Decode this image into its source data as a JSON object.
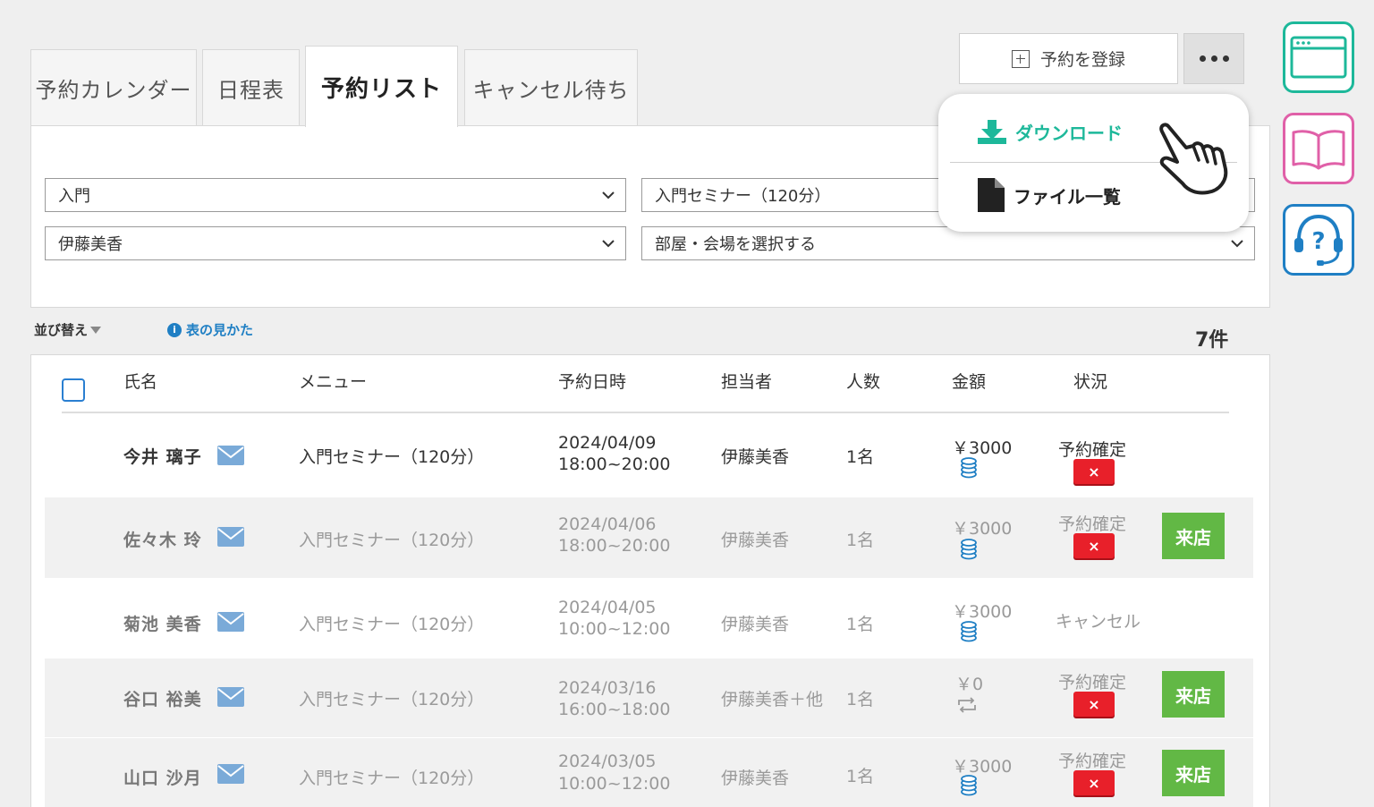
{
  "tabs": [
    {
      "label": "予約カレンダー"
    },
    {
      "label": "日程表"
    },
    {
      "label": "予約リスト"
    },
    {
      "label": "キャンセル待ち"
    }
  ],
  "toolbar": {
    "register_label": "予約を登録"
  },
  "dropdown": {
    "download_label": "ダウンロード",
    "files_label": "ファイル一覧"
  },
  "filters": {
    "category": "入門",
    "menu": "入門セミナー（120分）",
    "staff": "伊藤美香",
    "room_placeholder": "部屋・会場を選択する"
  },
  "list_meta": {
    "sort_label": "並び替え",
    "help_label": "表の見かた",
    "count": "7件"
  },
  "columns": {
    "name": "氏名",
    "menu": "メニュー",
    "datetime": "予約日時",
    "staff": "担当者",
    "people": "人数",
    "amount": "金額",
    "status": "状況"
  },
  "rows": [
    {
      "name": "今井 璃子",
      "menu": "入門セミナー（120分）",
      "date": "2024/04/09",
      "time": "18:00~20:00",
      "staff": "伊藤美香",
      "people": "1名",
      "amount": "￥3000",
      "status": "予約確定",
      "visit": ""
    },
    {
      "name": "佐々木 玲",
      "menu": "入門セミナー（120分）",
      "date": "2024/04/06",
      "time": "18:00~20:00",
      "staff": "伊藤美香",
      "people": "1名",
      "amount": "￥3000",
      "status": "予約確定",
      "visit": "来店"
    },
    {
      "name": "菊池 美香",
      "menu": "入門セミナー（120分）",
      "date": "2024/04/05",
      "time": "10:00~12:00",
      "staff": "伊藤美香",
      "people": "1名",
      "amount": "￥3000",
      "status": "キャンセル",
      "visit": ""
    },
    {
      "name": "谷口 裕美",
      "menu": "入門セミナー（120分）",
      "date": "2024/03/16",
      "time": "16:00~18:00",
      "staff": "伊藤美香＋他",
      "people": "1名",
      "amount": "￥0",
      "status": "予約確定",
      "visit": "来店"
    },
    {
      "name": "山口 沙月",
      "menu": "入門セミナー（120分）",
      "date": "2024/03/05",
      "time": "10:00~12:00",
      "staff": "伊藤美香",
      "people": "1名",
      "amount": "￥3000",
      "status": "予約確定",
      "visit": "来店"
    }
  ],
  "x_mark": "×",
  "icons": [
    "plus-square-icon",
    "more-dots-icon",
    "download-icon",
    "file-icon",
    "hand-pointer-icon",
    "window-icon",
    "book-icon",
    "support-headset-icon",
    "info-icon",
    "mail-icon",
    "coins-icon",
    "repeat-icon",
    "chevron-down-icon"
  ],
  "colors": {
    "accent_teal": "#1db89a",
    "accent_pink": "#e060a8",
    "accent_blue": "#1f7fc4",
    "cancel_red": "#e8202a",
    "visit_green": "#62b845"
  }
}
